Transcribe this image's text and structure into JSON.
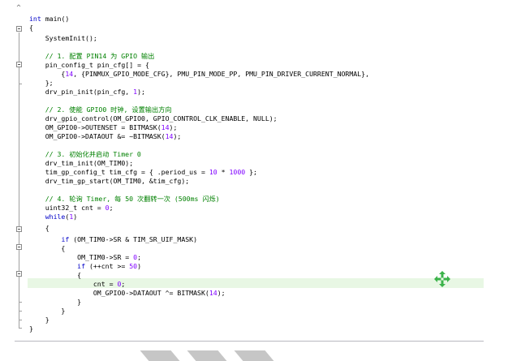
{
  "editor": {
    "lines": [
      "int main()",
      "{",
      "    SystemInit();",
      "",
      "    // 1. 配置 PIN14 为 GPIO 输出",
      "    pin_config_t pin_cfg[] = {",
      "        {14, {PINMUX_GPIO_MODE_CFG}, PMU_PIN_MODE_PP, PMU_PIN_DRIVER_CURRENT_NORMAL},",
      "    };",
      "    drv_pin_init(pin_cfg, 1);",
      "",
      "    // 2. 使能 GPIO0 时钟, 设置输出方向",
      "    drv_gpio_control(OM_GPIO0, GPIO_CONTROL_CLK_ENABLE, NULL);",
      "    OM_GPIO0->OUTENSET = BITMASK(14);",
      "    OM_GPIO0->DATAOUT &= ~BITMASK(14);",
      "",
      "    // 3. 初始化并启动 Timer 0",
      "    drv_tim_init(OM_TIM0);",
      "    tim_gp_config_t tim_cfg = { .period_us = 10 * 1000 };",
      "    drv_tim_gp_start(OM_TIM0, &tim_cfg);",
      "",
      "    // 4. 轮询 Timer, 每 50 次翻转一次 (500ms 闪烁)",
      "    uint32_t cnt = 0;",
      "    while(1)",
      "    {",
      "        if (OM_TIM0->SR & TIM_SR_UIF_MASK)",
      "        {",
      "            OM_TIM0->SR = 0;",
      "            if (++cnt >= 50)",
      "            {",
      "                cnt = 0;",
      "                OM_GPIO0->DATAOUT ^= BITMASK(14);",
      "            }",
      "        }",
      "    }",
      "}"
    ]
  },
  "colors": {
    "keyword": "#0000c8",
    "comment": "#008000",
    "number": "#7f00ff",
    "current_line": "#e8f7e4",
    "move_icon": "#3bb34a"
  },
  "icons": {
    "cursor": "move-cursor-icon",
    "fold": "fold-toggle-icon"
  }
}
